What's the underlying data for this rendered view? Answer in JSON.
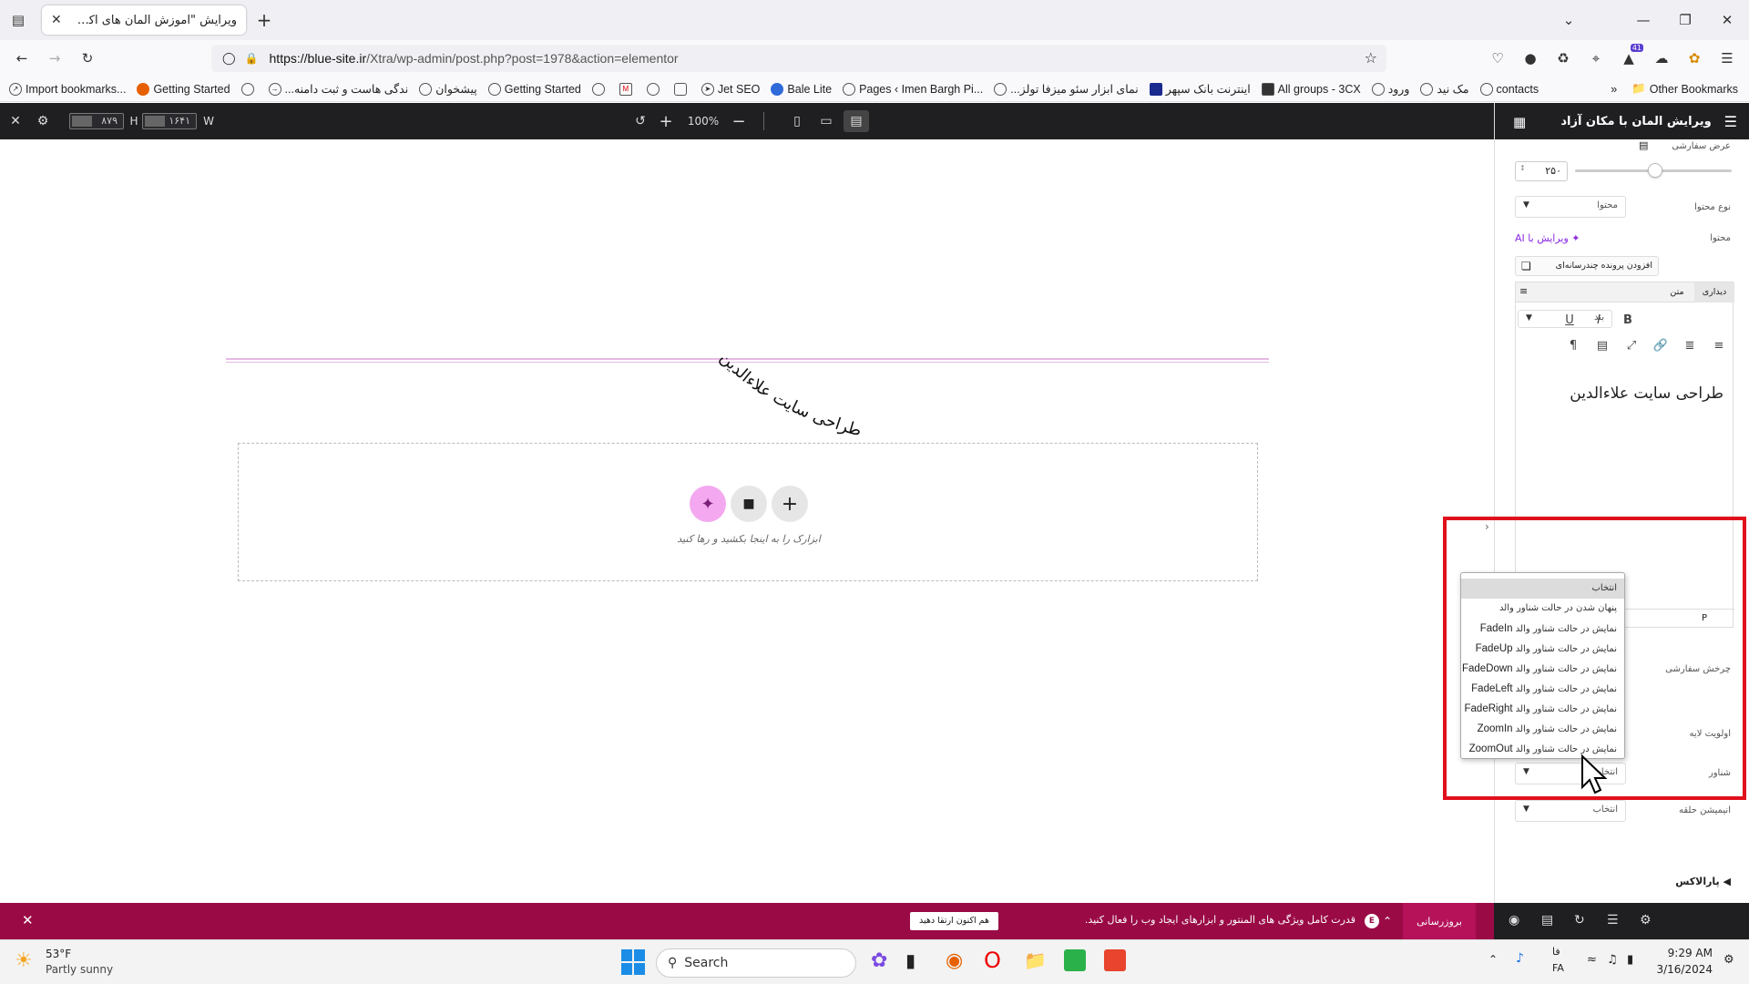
{
  "browser": {
    "tab_title": "ویرایش \"آموزش المان های اکسترا - مه",
    "url_host": "https://blue-site.ir",
    "url_path": "/Xtra/wp-admin/post.php?post=1978&action=elementor",
    "extension_badge": "41",
    "bookmarks": [
      "Import bookmarks...",
      "Getting Started",
      "...ندگی هاست و ثبت دامنه",
      "پیشخوان",
      "Getting Started",
      "Jet SEO",
      "Bale Lite",
      "Pages ‹ Imen Bargh Pi...",
      "...نمای ابزار سئو میزفا تولز",
      "اینترنت بانک سپهر",
      "All groups - 3CX",
      "ورود",
      "مک نید",
      "contacts"
    ],
    "other_bookmarks": "Other Bookmarks"
  },
  "elementor_bar": {
    "height_label": "H",
    "height_value": "۸۷۹",
    "width_label": "W",
    "width_value": "۱۶۴۱",
    "zoom": "100%"
  },
  "canvas": {
    "curved_text": "طراحی سایت علاءالدین",
    "drop_text": "ابزارک را به اینجا بکشید و رها کنید"
  },
  "panel": {
    "title": "ویرایش المان با مکان آزاد",
    "custom_width_label": "عرض سفارشی",
    "width_value": "۲۵۰",
    "content_type_label": "نوع محتوا",
    "content_type_value": "محتوا",
    "content_label": "محتوا",
    "ai_edit_label": "ویرایش با AI",
    "add_media_label": "افزودن پرونده چندرسانه‌ای",
    "tab_visual": "دیداری",
    "tab_text": "متن",
    "paragraph_select": "بند",
    "editor_text": "طراحی سایت علاءالدین",
    "path_p": "P",
    "custom_rotate_label": "چرخش سفارشی",
    "layer_priority_label": "اولویت لایه",
    "floating_label": "شناور",
    "floating_value": "انتخاب",
    "loop_anim_label": "انیمیشن حلقه",
    "loop_anim_value": "انتخاب",
    "parallax_label": "پارالاکس"
  },
  "dropdown": {
    "options": [
      {
        "fa": "انتخاب",
        "en": ""
      },
      {
        "fa": "پنهان شدن در حالت شناور والد",
        "en": ""
      },
      {
        "fa": "نمایش در حالت شناور والد",
        "en": "FadeIn"
      },
      {
        "fa": "نمایش در حالت شناور والد",
        "en": "FadeUp"
      },
      {
        "fa": "نمایش در حالت شناور والد",
        "en": "FadeDown"
      },
      {
        "fa": "نمایش در حالت شناور والد",
        "en": "FadeLeft"
      },
      {
        "fa": "نمایش در حالت شناور والد",
        "en": "FadeRight"
      },
      {
        "fa": "نمایش در حالت شناور والد",
        "en": "ZoomIn"
      },
      {
        "fa": "نمایش در حالت شناور والد",
        "en": "ZoomOut"
      }
    ],
    "selected_index": 0
  },
  "promo": {
    "text": "قدرت کامل ویژگی های المنتور و ابزارهای ایجاد وب را فعال کنید.",
    "button": "هم اکنون ارتقا دهید",
    "update_label": "بروزرسانی"
  },
  "taskbar": {
    "temp": "53°F",
    "weather": "Partly sunny",
    "search_placeholder": "Search",
    "lang_top": "فا",
    "lang_bottom": "FA",
    "time": "9:29 AM",
    "date": "3/16/2024"
  },
  "colors": {
    "accent_pink": "#9a0b46",
    "highlight_red": "#e0101c",
    "dark_bar": "#1f1f22"
  }
}
